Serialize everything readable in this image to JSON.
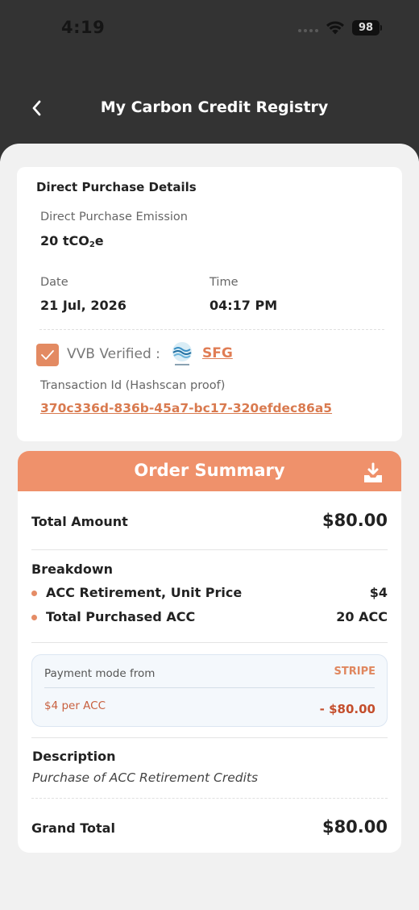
{
  "status_bar": {
    "time": "4:19",
    "battery": "98"
  },
  "header": {
    "title": "My Carbon Credit Registry"
  },
  "purchase_details": {
    "title": "Direct Purchase Details",
    "emission_label": "Direct Purchase Emission",
    "emission_value": "20 tCO",
    "emission_unit_suffix": "e",
    "date_label": "Date",
    "date_value": "21 Jul, 2026",
    "time_label": "Time",
    "time_value": "04:17 PM",
    "vvb_label": "VVB Verified :",
    "vvb_name": "SFG",
    "vvb_checked": true,
    "transaction_label": "Transaction Id (Hashscan proof)",
    "transaction_id": "370c336d-836b-45a7-bc17-320efdec86a5"
  },
  "order_summary": {
    "title": "Order Summary",
    "total_amount_label": "Total Amount",
    "total_amount": "$80.00",
    "breakdown_label": "Breakdown",
    "breakdown": [
      {
        "label": "ACC Retirement, Unit Price",
        "value": "$4"
      },
      {
        "label": "Total Purchased ACC",
        "value": "20 ACC"
      }
    ],
    "payment": {
      "mode_label": "Payment mode from",
      "provider": "STRIPE",
      "rate": "$4 per ACC",
      "amount": "- $80.00"
    },
    "description_label": "Description",
    "description": "Purchase of ACC Retirement Credits",
    "grand_total_label": "Grand Total",
    "grand_total": "$80.00"
  },
  "colors": {
    "accent": "#ef916b",
    "link": "#d97a4f",
    "header_bg": "#333333",
    "page_bg": "#f1f1f1"
  }
}
